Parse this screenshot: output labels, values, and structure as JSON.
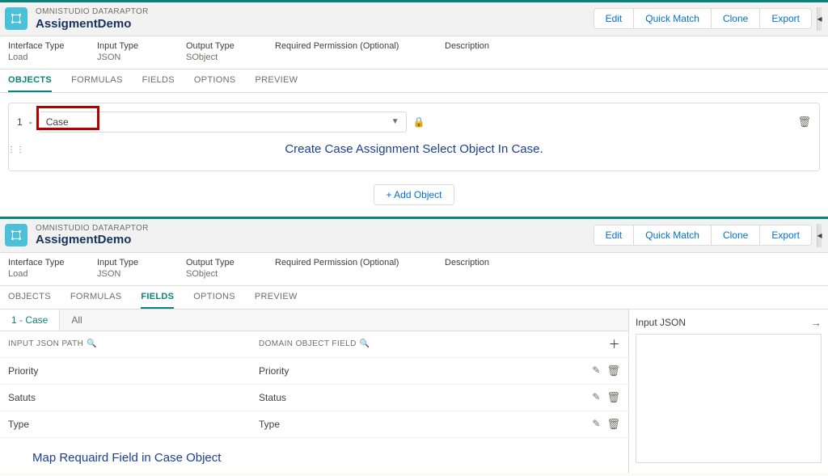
{
  "panel1": {
    "eyebrow": "OMNISTUDIO DATARAPTOR",
    "name": "AssigmentDemo",
    "buttons": {
      "edit": "Edit",
      "quickmatch": "Quick Match",
      "clone": "Clone",
      "export": "Export"
    },
    "details": {
      "interfaceType": {
        "label": "Interface Type",
        "value": "Load"
      },
      "inputType": {
        "label": "Input Type",
        "value": "JSON"
      },
      "outputType": {
        "label": "Output Type",
        "value": "SObject"
      },
      "reqPerm": {
        "label": "Required Permission (Optional)",
        "value": ""
      },
      "description": {
        "label": "Description",
        "value": ""
      }
    },
    "tabs": {
      "objects": "OBJECTS",
      "formulas": "FORMULAS",
      "fields": "FIELDS",
      "options": "OPTIONS",
      "preview": "PREVIEW"
    },
    "objectRow": {
      "index": "1",
      "dash": "-",
      "value": "Case"
    },
    "caption": "Create Case Assignment Select Object In Case.",
    "addObject": "+ Add Object"
  },
  "panel2": {
    "eyebrow": "OMNISTUDIO DATARAPTOR",
    "name": "AssigmentDemo",
    "buttons": {
      "edit": "Edit",
      "quickmatch": "Quick Match",
      "clone": "Clone",
      "export": "Export"
    },
    "details": {
      "interfaceType": {
        "label": "Interface Type",
        "value": "Load"
      },
      "inputType": {
        "label": "Input Type",
        "value": "JSON"
      },
      "outputType": {
        "label": "Output Type",
        "value": "SObject"
      },
      "reqPerm": {
        "label": "Required Permission (Optional)",
        "value": ""
      },
      "description": {
        "label": "Description",
        "value": ""
      }
    },
    "tabs": {
      "objects": "OBJECTS",
      "formulas": "FORMULAS",
      "fields": "FIELDS",
      "options": "OPTIONS",
      "preview": "PREVIEW"
    },
    "subtabs": {
      "first": "1 - Case",
      "all": "All"
    },
    "columnHeads": {
      "input": "INPUT JSON PATH",
      "domain": "DOMAIN OBJECT FIELD"
    },
    "rows": [
      {
        "input": "Priority",
        "domain": "Priority"
      },
      {
        "input": "Satuts",
        "domain": "Status"
      },
      {
        "input": "Type",
        "domain": "Type"
      }
    ],
    "caption": "Map Requaird Field in Case Object",
    "jsonPanel": {
      "title": "Input JSON"
    }
  }
}
